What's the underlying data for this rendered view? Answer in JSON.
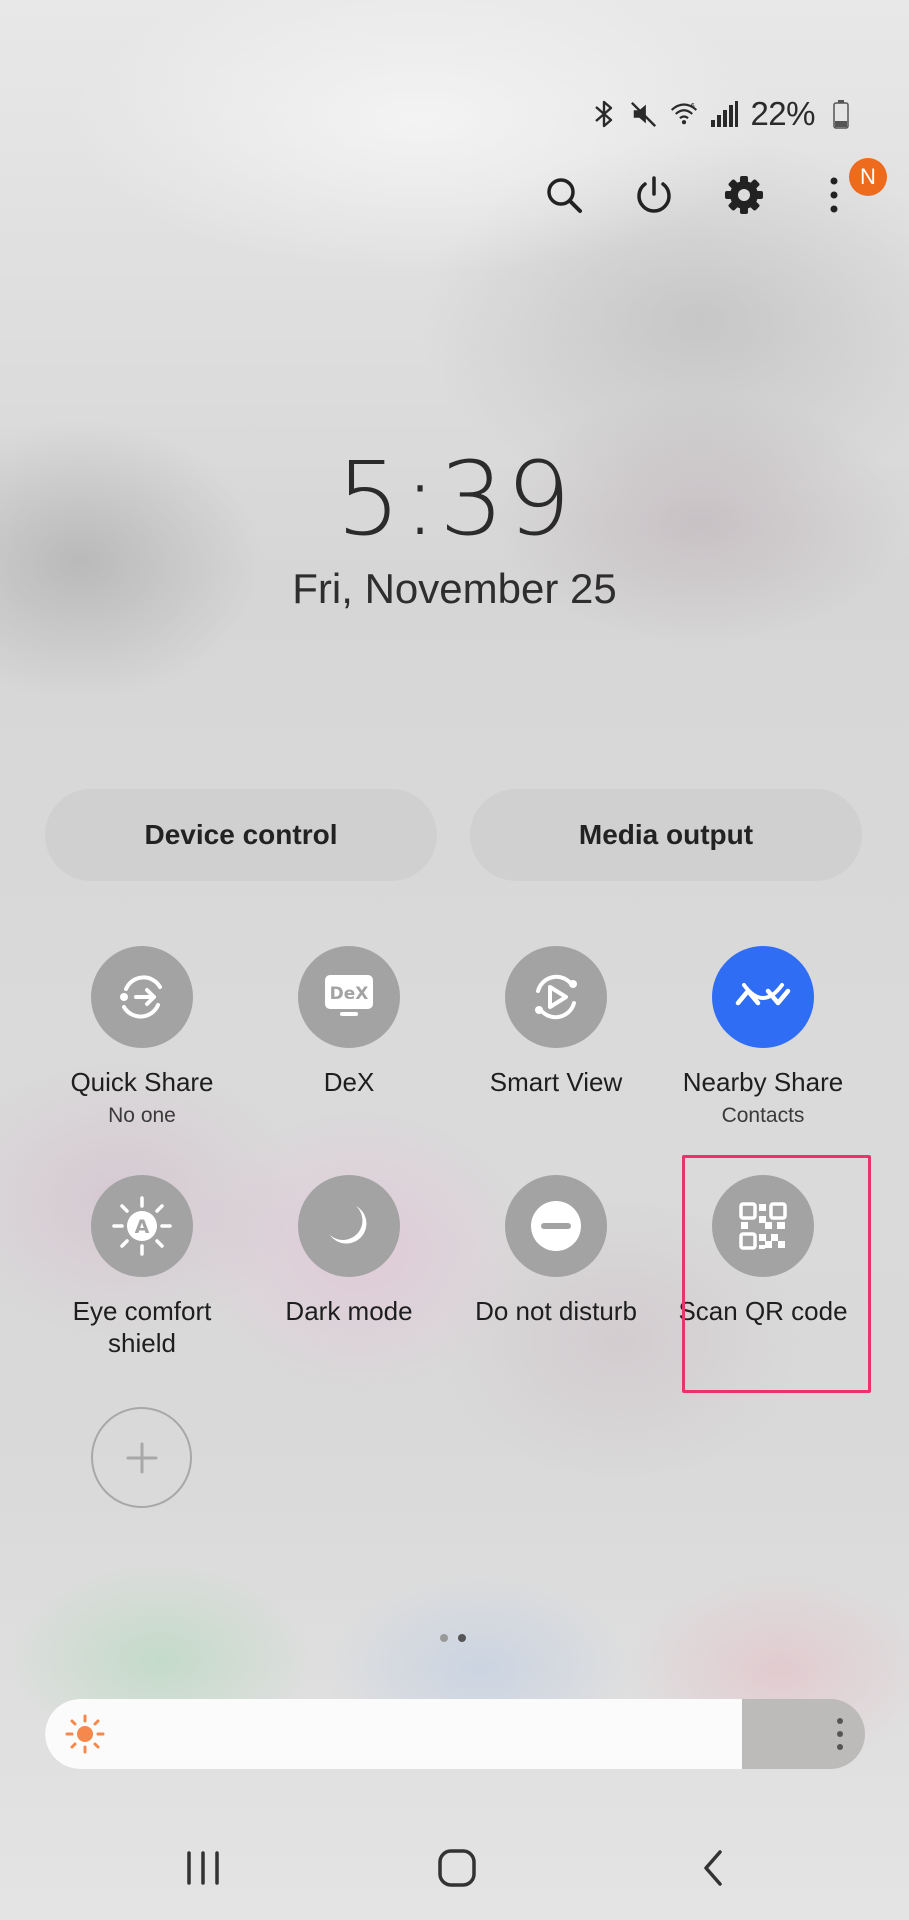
{
  "status_bar": {
    "icons": [
      "bluetooth-icon",
      "mute-icon",
      "wifi-icon",
      "signal-icon",
      "battery-icon"
    ],
    "battery_percent": "22%"
  },
  "top_actions": {
    "icons": [
      "search-icon",
      "power-icon",
      "settings-icon",
      "more-icon"
    ],
    "notification_badge": "N",
    "badge_color": "#ee6a1c"
  },
  "clock": {
    "time": "5:39",
    "date": "Fri, November 25"
  },
  "buttons": {
    "device_control": "Device control",
    "media_output": "Media output"
  },
  "tiles": [
    {
      "label": "Quick Share",
      "sub": "No one",
      "icon": "quick-share-icon",
      "active": false
    },
    {
      "label": "DeX",
      "sub": "",
      "icon": "dex-icon",
      "active": false
    },
    {
      "label": "Smart View",
      "sub": "",
      "icon": "smart-view-icon",
      "active": false
    },
    {
      "label": "Nearby Share",
      "sub": "Contacts",
      "icon": "nearby-share-icon",
      "active": true
    },
    {
      "label": "Eye comfort shield",
      "sub": "",
      "icon": "eye-comfort-icon",
      "active": false
    },
    {
      "label": "Dark mode",
      "sub": "",
      "icon": "moon-icon",
      "active": false
    },
    {
      "label": "Do not disturb",
      "sub": "",
      "icon": "do-not-disturb-icon",
      "active": false
    },
    {
      "label": "Scan QR code",
      "sub": "",
      "icon": "qr-code-icon",
      "active": false
    }
  ],
  "dex_icon_text": "DeX",
  "eye_comfort_icon_text": "A",
  "active_color": "#2f6df5",
  "highlight_color": "#e8336b",
  "page_indicator": {
    "count": 2,
    "current": 2
  },
  "brightness": {
    "level": 0.85
  },
  "nav_bar": [
    "recents-button",
    "home-button",
    "back-button"
  ]
}
